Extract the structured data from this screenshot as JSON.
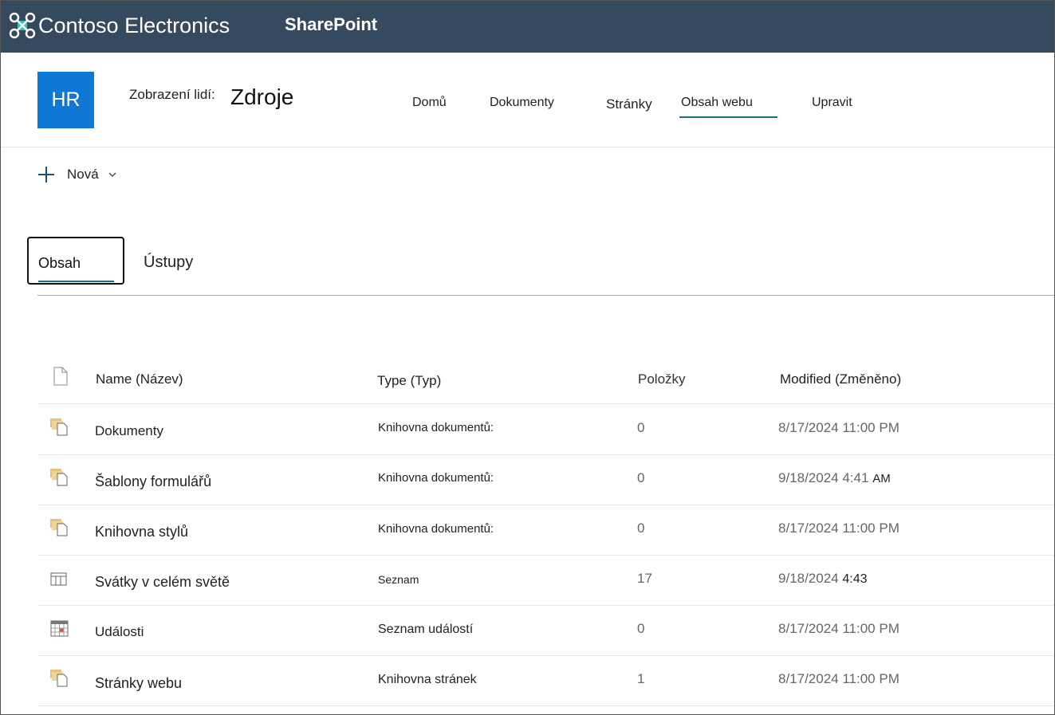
{
  "suite": {
    "org_name": "Contoso Electronics",
    "app_name": "SharePoint",
    "color": "#354a5f"
  },
  "site": {
    "logo_text": "HR",
    "logo_color": "#0f78d4",
    "title_prefix": "Zobrazení lidí:",
    "title": "Zdroje",
    "nav": [
      {
        "label": "Domů"
      },
      {
        "label": "Dokumenty"
      },
      {
        "label": "Stránky"
      },
      {
        "label": "Obsah webu",
        "active": true
      },
      {
        "label": "Upravit"
      }
    ]
  },
  "command_bar": {
    "new_label": "Nová"
  },
  "tabs": [
    {
      "label": "Obsah",
      "selected": true
    },
    {
      "label": "Ústupy"
    }
  ],
  "table": {
    "columns": {
      "name": "Name (Název)",
      "type": "Type (Typ)",
      "items": "Položky",
      "modified": "Modified (Změněno)"
    },
    "rows": [
      {
        "icon": "document-library-icon",
        "name": "Dokumenty",
        "type": "Knihovna dokumentů:",
        "items": "0",
        "modified": "8/17/2024 11:00 PM"
      },
      {
        "icon": "document-library-icon",
        "name": "Šablony formulářů",
        "type": "Knihovna dokumentů:",
        "items": "0",
        "modified_date": "9/18/2024 4:41",
        "modified_suffix": "AM"
      },
      {
        "icon": "document-library-icon",
        "name": "Knihovna stylů",
        "type": "Knihovna dokumentů:",
        "items": "0",
        "modified": "8/17/2024 11:00 PM"
      },
      {
        "icon": "list-icon",
        "name": "Svátky v celém světě",
        "type": "Seznam",
        "items": "17",
        "modified_date": "9/18/2024",
        "modified_suffix": "4:43"
      },
      {
        "icon": "calendar-icon",
        "name": "Události",
        "type": "Seznam událostí",
        "items": "0",
        "modified": "8/17/2024 11:00 PM"
      },
      {
        "icon": "document-library-icon",
        "name": "Stránky webu",
        "type": "Knihovna stránek",
        "items": "1",
        "modified": "8/17/2024 11:00 PM"
      }
    ]
  }
}
